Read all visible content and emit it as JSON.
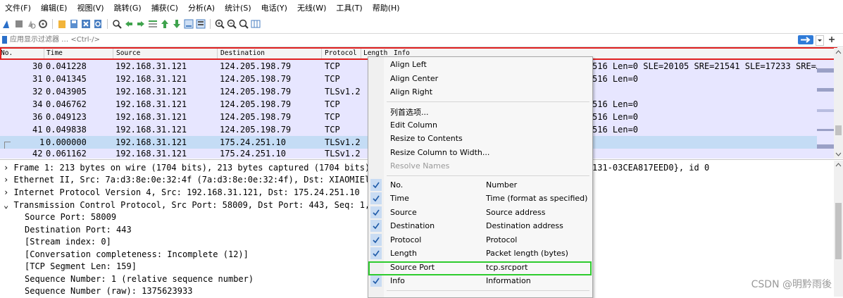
{
  "menubar": [
    "文件(F)",
    "编辑(E)",
    "视图(V)",
    "跳转(G)",
    "捕获(C)",
    "分析(A)",
    "统计(S)",
    "电话(Y)",
    "无线(W)",
    "工具(T)",
    "帮助(H)"
  ],
  "filter": {
    "placeholder": "应用显示过滤器 … <Ctrl-/>"
  },
  "packet_list": {
    "columns": [
      "No.",
      "Time",
      "Source",
      "Destination",
      "Protocol",
      "Length",
      "Info"
    ],
    "rows": [
      {
        "no": "30",
        "time": "0.041228",
        "src": "192.168.31.121",
        "dst": "124.205.198.79",
        "proto": "TCP",
        "info": "516 Len=0 SLE=20105 SRE=21541 SLE=17233 SRE=…"
      },
      {
        "no": "31",
        "time": "0.041345",
        "src": "192.168.31.121",
        "dst": "124.205.198.79",
        "proto": "TCP",
        "info": "516 Len=0"
      },
      {
        "no": "32",
        "time": "0.043905",
        "src": "192.168.31.121",
        "dst": "124.205.198.79",
        "proto": "TLSv1.2",
        "info": ""
      },
      {
        "no": "34",
        "time": "0.046762",
        "src": "192.168.31.121",
        "dst": "124.205.198.79",
        "proto": "TCP",
        "info": "516 Len=0"
      },
      {
        "no": "36",
        "time": "0.049123",
        "src": "192.168.31.121",
        "dst": "124.205.198.79",
        "proto": "TCP",
        "info": "516 Len=0"
      },
      {
        "no": "41",
        "time": "0.049838",
        "src": "192.168.31.121",
        "dst": "124.205.198.79",
        "proto": "TCP",
        "info": "516 Len=0"
      },
      {
        "no": "1",
        "time": "0.000000",
        "src": "192.168.31.121",
        "dst": "175.24.251.10",
        "proto": "TLSv1.2",
        "info": ""
      },
      {
        "no": "42",
        "time": "0.061162",
        "src": "192.168.31.121",
        "dst": "175.24.251.10",
        "proto": "TLSv1.2",
        "info": ""
      }
    ]
  },
  "details": [
    {
      "text": "Frame 1: 213 bytes on wire (1704 bits), 213 bytes captured (1704 bits) o",
      "right": "131-03CEA817EED0}, id 0"
    },
    {
      "text": "Ethernet II, Src: 7a:d3:8e:0e:32:4f (7a:d3:8e:0e:32:4f), Dst: XIAOMIEl_5"
    },
    {
      "text": "Internet Protocol Version 4, Src: 192.168.31.121, Dst: 175.24.251.10"
    },
    {
      "text": "Transmission Control Protocol, Src Port: 58009, Dst Port: 443, Seq: 1, A"
    },
    {
      "text": "Source Port: 58009"
    },
    {
      "text": "Destination Port: 443"
    },
    {
      "text": "[Stream index: 0]"
    },
    {
      "text": "[Conversation completeness: Incomplete (12)]"
    },
    {
      "text": "[TCP Segment Len: 159]"
    },
    {
      "text": "Sequence Number: 1    (relative sequence number)"
    },
    {
      "text": "Sequence Number (raw): 1375623933"
    }
  ],
  "context_menu": {
    "align_left": "Align Left",
    "align_center": "Align Center",
    "align_right": "Align Right",
    "column_prefs": "列首选项...",
    "edit_column": "Edit Column",
    "resize_contents": "Resize to Contents",
    "resize_width": "Resize Column to Width...",
    "resolve_names": "Resolve Names",
    "columns": [
      {
        "name": "No.",
        "desc": "Number",
        "checked": true
      },
      {
        "name": "Time",
        "desc": "Time (format as specified)",
        "checked": true
      },
      {
        "name": "Source",
        "desc": "Source address",
        "checked": true
      },
      {
        "name": "Destination",
        "desc": "Destination address",
        "checked": true
      },
      {
        "name": "Protocol",
        "desc": "Protocol",
        "checked": true
      },
      {
        "name": "Length",
        "desc": "Packet length (bytes)",
        "checked": true
      },
      {
        "name": "Source Port",
        "desc": "tcp.srcport",
        "checked": false
      },
      {
        "name": "Info",
        "desc": "Information",
        "checked": true
      }
    ]
  },
  "watermark": "CSDN @明黔雨後",
  "colors": {
    "row_bg": "#e7e6ff",
    "row_selected": "#c4dcf5",
    "highlight_red": "#e02020",
    "highlight_green": "#2ecc2e",
    "check_bg": "#c9dcf3"
  },
  "icons": [
    "shark-fin-icon",
    "stop-icon",
    "restart-icon",
    "options-icon",
    "open-icon",
    "save-icon",
    "close-icon",
    "reload-icon",
    "find-icon",
    "back-icon",
    "forward-icon",
    "goto-icon",
    "first-icon",
    "last-icon",
    "autoscroll-icon",
    "colorize-icon",
    "zoom-in-icon",
    "zoom-out-icon",
    "zoom-reset-icon",
    "resize-columns-icon"
  ]
}
